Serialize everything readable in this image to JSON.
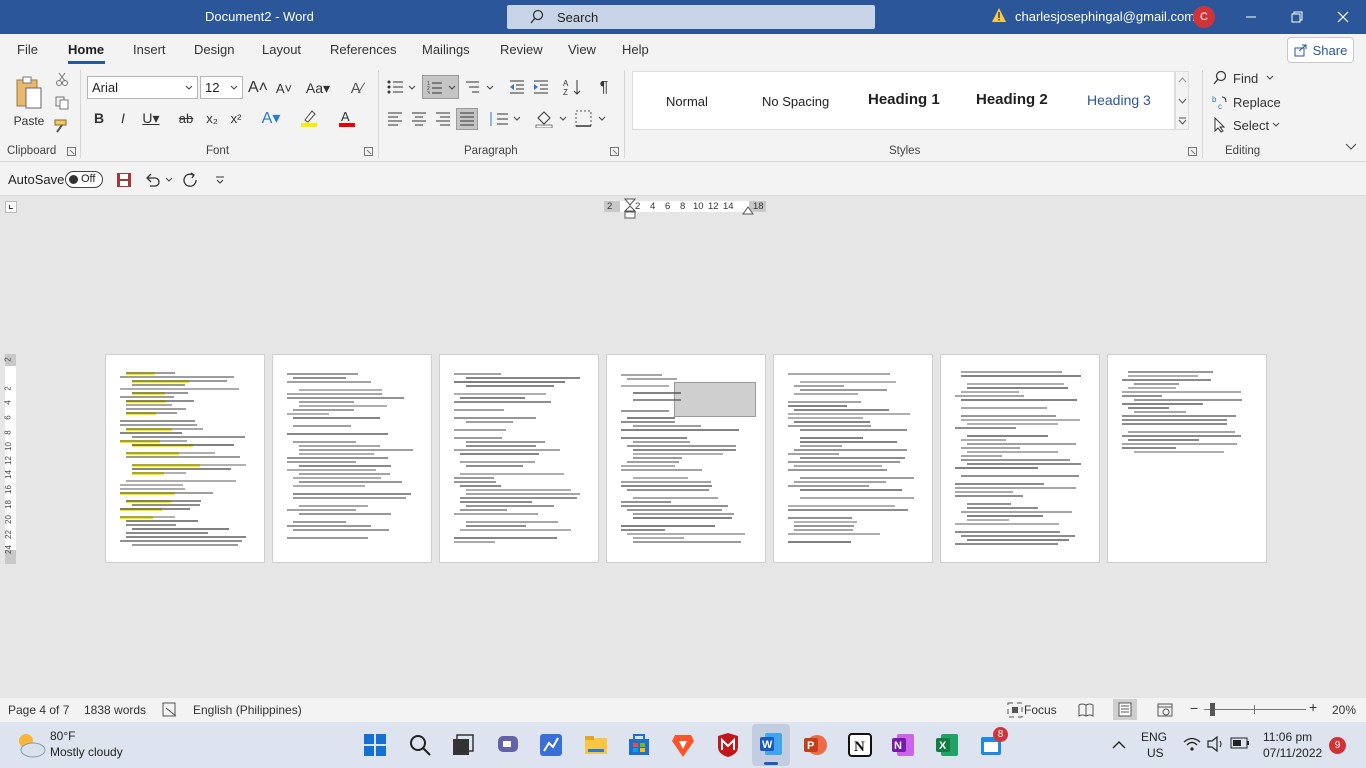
{
  "titlebar": {
    "doc_title": "Document2  -  Word",
    "search_label": "Search",
    "account": "charlesjosephingal@gmail.com",
    "avatar_letter": "C"
  },
  "tabs": [
    "File",
    "Home",
    "Insert",
    "Design",
    "Layout",
    "References",
    "Mailings",
    "Review",
    "View",
    "Help"
  ],
  "share_label": "Share",
  "ribbon": {
    "paste_label": "Paste",
    "font_name": "Arial",
    "font_size": "12",
    "styles": [
      "Normal",
      "No Spacing",
      "Heading 1",
      "Heading 2",
      "Heading 3"
    ],
    "find_label": "Find",
    "replace_label": "Replace",
    "select_label": "Select",
    "group_labels": {
      "clipboard": "Clipboard",
      "font": "Font",
      "paragraph": "Paragraph",
      "styles": "Styles",
      "editing": "Editing"
    }
  },
  "qat": {
    "autosave_label": "AutoSave",
    "autosave_state": "Off"
  },
  "ruler": {
    "numbers": [
      "2",
      "2",
      "4",
      "6",
      "8",
      "10",
      "12",
      "14",
      "18"
    ]
  },
  "vruler": {
    "numbers": [
      "2",
      "2",
      "4",
      "6",
      "8",
      "10",
      "12",
      "14",
      "16",
      "18",
      "20",
      "22",
      "24"
    ]
  },
  "status": {
    "page": "Page 4 of 7",
    "words": "1838 words",
    "language": "English (Philippines)",
    "focus": "Focus",
    "zoom": "20%"
  },
  "taskbar": {
    "weather_temp": "80°F",
    "weather_desc": "Mostly cloudy",
    "lang_top": "ENG",
    "lang_bottom": "US",
    "time": "11:06 pm",
    "date": "07/11/2022",
    "notif_count": "9",
    "store_badge": "8"
  },
  "colors": {
    "word_blue": "#2b579a",
    "highlight": "#f4f000"
  }
}
